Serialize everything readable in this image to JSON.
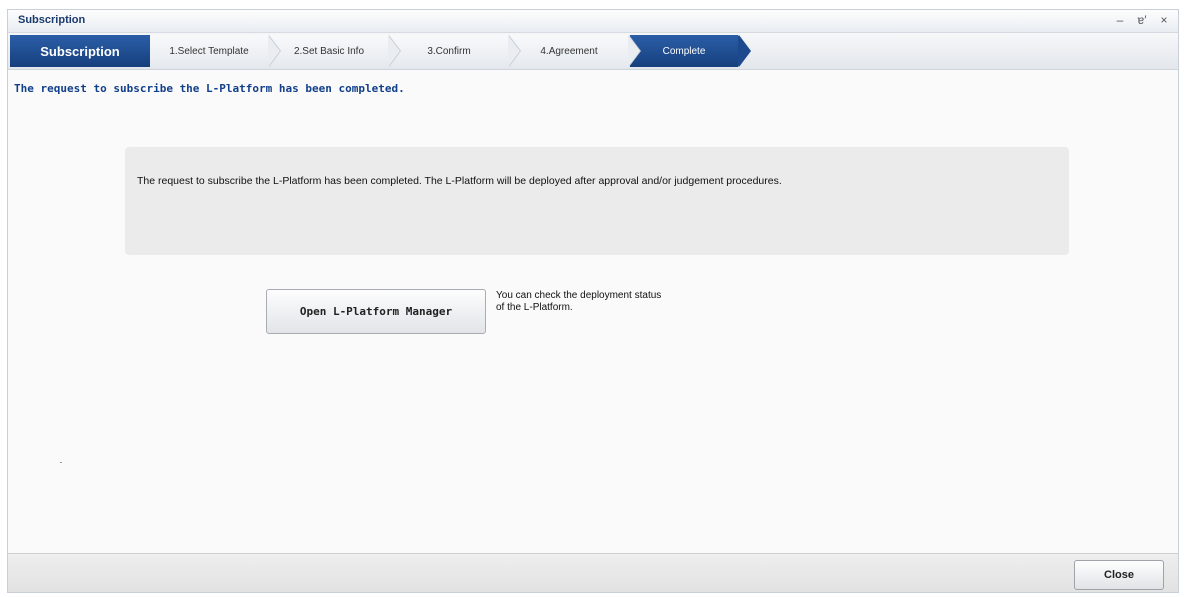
{
  "window": {
    "title": "Subscription",
    "controls": {
      "minimize": "–",
      "restore": "ɐ′",
      "close": "×"
    }
  },
  "wizard": {
    "header_label": "Subscription",
    "steps": [
      {
        "label": "1.Select Template",
        "state": "done"
      },
      {
        "label": "2.Set Basic Info",
        "state": "done"
      },
      {
        "label": "3.Confirm",
        "state": "done"
      },
      {
        "label": "4.Agreement",
        "state": "done"
      },
      {
        "label": "Complete",
        "state": "active"
      }
    ]
  },
  "main": {
    "headline": "The request to subscribe the L-Platform has been completed.",
    "info_message": "The request to subscribe the L-Platform has been completed. The L-Platform will be deployed after approval and/or judgement procedures.",
    "open_button_label": "Open L-Platform Manager",
    "open_hint_line1": "You can check the deployment status",
    "open_hint_line2": "of the L-Platform."
  },
  "footer": {
    "close_label": "Close"
  },
  "colors": {
    "accent": "#163f7d",
    "headline": "#123f8a"
  }
}
